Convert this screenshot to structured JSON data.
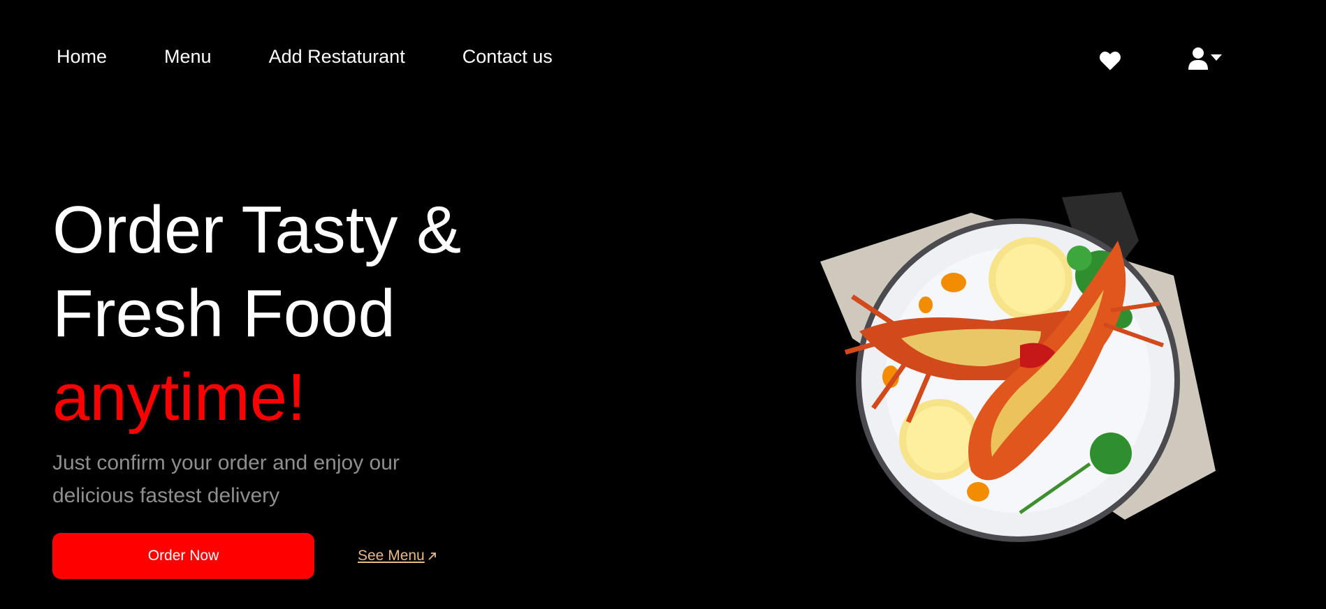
{
  "nav": {
    "items": [
      {
        "label": "Home"
      },
      {
        "label": "Menu"
      },
      {
        "label": "Add Restaturant"
      },
      {
        "label": "Contact us"
      }
    ],
    "icons": [
      "heart-icon",
      "user-icon",
      "caret-down-icon"
    ]
  },
  "hero": {
    "title_line1": "Order Tasty &",
    "title_line2": "Fresh Food",
    "title_accent": "anytime!",
    "subtitle": "Just confirm your order and enjoy our delicious fastest delivery",
    "order_button": "Order Now",
    "see_menu_link": "See Menu"
  },
  "colors": {
    "background": "#000000",
    "accent": "#ff0000",
    "subtitle": "#8f8f8f",
    "link": "#e8b982"
  }
}
